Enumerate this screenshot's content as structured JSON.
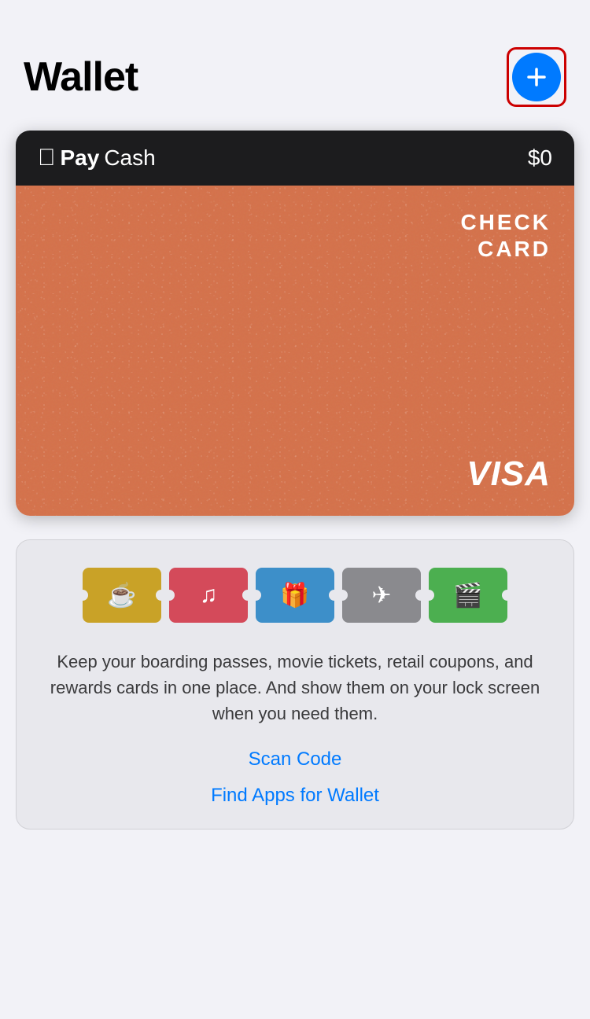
{
  "header": {
    "title": "Wallet",
    "add_button_label": "+"
  },
  "apple_pay": {
    "logo_apple": "🍎",
    "logo_pay": "Pay",
    "logo_cash": "Cash",
    "balance": "$0"
  },
  "visa_card": {
    "check_card_line1": "CHECK",
    "check_card_line2": "CARD",
    "brand": "VISA"
  },
  "passes": {
    "icons": [
      {
        "type": "coffee",
        "label": "coffee-icon",
        "symbol": "☕"
      },
      {
        "type": "music",
        "label": "music-icon",
        "symbol": "♪"
      },
      {
        "type": "gift",
        "label": "gift-icon",
        "symbol": "🎁"
      },
      {
        "type": "plane",
        "label": "plane-icon",
        "symbol": "✈"
      },
      {
        "type": "movie",
        "label": "movie-icon",
        "symbol": "🎬"
      }
    ],
    "description": "Keep your boarding passes, movie tickets, retail coupons, and rewards cards in one place. And show them on your lock screen when you need them.",
    "scan_code": "Scan Code",
    "find_apps": "Find Apps for Wallet"
  }
}
